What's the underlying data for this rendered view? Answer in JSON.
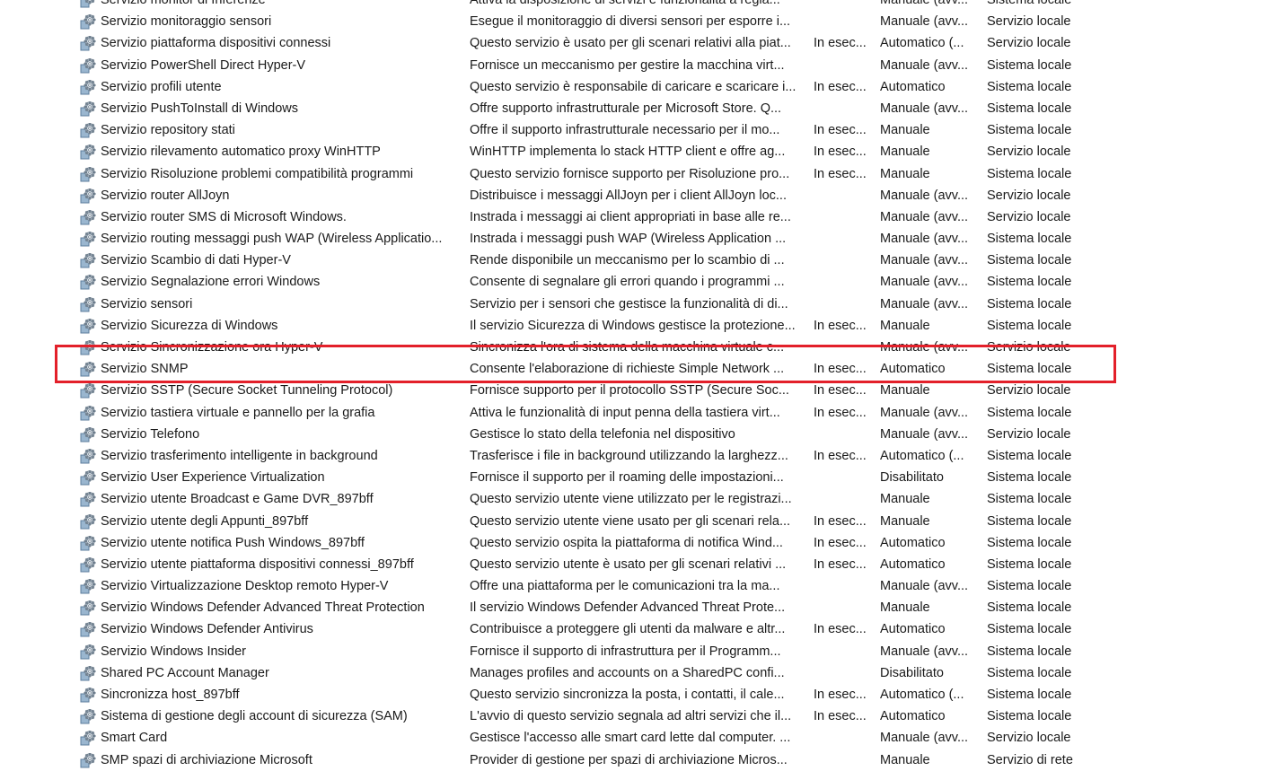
{
  "highlight_color": "#e3202a",
  "row_icon": "gear-icon",
  "services": [
    {
      "name": "Servizio monitor di Inferenze",
      "description": "Attiva la disposizione di servizi e funzionalità a regia...",
      "status": "",
      "startup": "Manuale (avv...",
      "logon": "Sistema locale"
    },
    {
      "name": "Servizio monitoraggio sensori",
      "description": "Esegue il monitoraggio di diversi sensori per esporre i...",
      "status": "",
      "startup": "Manuale (avv...",
      "logon": "Servizio locale"
    },
    {
      "name": "Servizio piattaforma dispositivi connessi",
      "description": "Questo servizio è usato per gli scenari relativi alla piat...",
      "status": "In esec...",
      "startup": "Automatico (...",
      "logon": "Servizio locale"
    },
    {
      "name": "Servizio PowerShell Direct Hyper-V",
      "description": "Fornisce un meccanismo per gestire la macchina virt...",
      "status": "",
      "startup": "Manuale (avv...",
      "logon": "Sistema locale"
    },
    {
      "name": "Servizio profili utente",
      "description": "Questo servizio è responsabile di caricare e scaricare i...",
      "status": "In esec...",
      "startup": "Automatico",
      "logon": "Sistema locale"
    },
    {
      "name": "Servizio PushToInstall di Windows",
      "description": "Offre supporto infrastrutturale per Microsoft Store. Q...",
      "status": "",
      "startup": "Manuale (avv...",
      "logon": "Sistema locale"
    },
    {
      "name": "Servizio repository stati",
      "description": "Offre il supporto infrastrutturale necessario per il mo...",
      "status": "In esec...",
      "startup": "Manuale",
      "logon": "Sistema locale"
    },
    {
      "name": "Servizio rilevamento automatico proxy WinHTTP",
      "description": "WinHTTP implementa lo stack HTTP client e offre ag...",
      "status": "In esec...",
      "startup": "Manuale",
      "logon": "Servizio locale"
    },
    {
      "name": "Servizio Risoluzione problemi compatibilità programmi",
      "description": "Questo servizio fornisce supporto per Risoluzione pro...",
      "status": "In esec...",
      "startup": "Manuale",
      "logon": "Sistema locale"
    },
    {
      "name": "Servizio router AllJoyn",
      "description": "Distribuisce i messaggi AllJoyn per i client AllJoyn loc...",
      "status": "",
      "startup": "Manuale (avv...",
      "logon": "Servizio locale"
    },
    {
      "name": "Servizio router SMS di Microsoft Windows.",
      "description": "Instrada i messaggi ai client appropriati in base alle re...",
      "status": "",
      "startup": "Manuale (avv...",
      "logon": "Servizio locale"
    },
    {
      "name": "Servizio routing messaggi push WAP (Wireless Applicatio...",
      "description": "Instrada i messaggi push WAP (Wireless Application ...",
      "status": "",
      "startup": "Manuale (avv...",
      "logon": "Sistema locale"
    },
    {
      "name": "Servizio Scambio di dati Hyper-V",
      "description": "Rende disponibile un meccanismo per lo scambio di ...",
      "status": "",
      "startup": "Manuale (avv...",
      "logon": "Sistema locale"
    },
    {
      "name": "Servizio Segnalazione errori Windows",
      "description": "Consente di segnalare gli errori quando i programmi ...",
      "status": "",
      "startup": "Manuale (avv...",
      "logon": "Sistema locale"
    },
    {
      "name": "Servizio sensori",
      "description": "Servizio per i sensori che gestisce la funzionalità di di...",
      "status": "",
      "startup": "Manuale (avv...",
      "logon": "Sistema locale"
    },
    {
      "name": "Servizio Sicurezza di Windows",
      "description": "Il servizio Sicurezza di Windows gestisce la protezione...",
      "status": "In esec...",
      "startup": "Manuale",
      "logon": "Sistema locale"
    },
    {
      "name": "Servizio Sincronizzazione ora Hyper-V",
      "description": "Sincronizza l'ora di sistema della macchina virtuale c...",
      "status": "",
      "startup": "Manuale (avv...",
      "logon": "Servizio locale"
    },
    {
      "name": "Servizio SNMP",
      "description": "Consente l'elaborazione di richieste Simple Network ...",
      "status": "In esec...",
      "startup": "Automatico",
      "logon": "Sistema locale",
      "highlighted": true
    },
    {
      "name": "Servizio SSTP (Secure Socket Tunneling Protocol)",
      "description": "Fornisce supporto per il protocollo SSTP (Secure Soc...",
      "status": "In esec...",
      "startup": "Manuale",
      "logon": "Servizio locale"
    },
    {
      "name": "Servizio tastiera virtuale e pannello per la grafia",
      "description": "Attiva le funzionalità di input penna della tastiera virt...",
      "status": "In esec...",
      "startup": "Manuale (avv...",
      "logon": "Sistema locale"
    },
    {
      "name": "Servizio Telefono",
      "description": "Gestisce lo stato della telefonia nel dispositivo",
      "status": "",
      "startup": "Manuale (avv...",
      "logon": "Servizio locale"
    },
    {
      "name": "Servizio trasferimento intelligente in background",
      "description": "Trasferisce i file in background utilizzando la larghezz...",
      "status": "In esec...",
      "startup": "Automatico (...",
      "logon": "Sistema locale"
    },
    {
      "name": "Servizio User Experience Virtualization",
      "description": "Fornisce il supporto per il roaming delle impostazioni...",
      "status": "",
      "startup": "Disabilitato",
      "logon": "Sistema locale"
    },
    {
      "name": "Servizio utente Broadcast e Game DVR_897bff",
      "description": "Questo servizio utente viene utilizzato per le registrazi...",
      "status": "",
      "startup": "Manuale",
      "logon": "Sistema locale"
    },
    {
      "name": "Servizio utente degli Appunti_897bff",
      "description": "Questo servizio utente viene usato per gli scenari rela...",
      "status": "In esec...",
      "startup": "Manuale",
      "logon": "Sistema locale"
    },
    {
      "name": "Servizio utente notifica Push Windows_897bff",
      "description": "Questo servizio ospita la piattaforma di notifica Wind...",
      "status": "In esec...",
      "startup": "Automatico",
      "logon": "Sistema locale"
    },
    {
      "name": "Servizio utente piattaforma dispositivi connessi_897bff",
      "description": "Questo servizio utente è usato per gli scenari relativi ...",
      "status": "In esec...",
      "startup": "Automatico",
      "logon": "Sistema locale"
    },
    {
      "name": "Servizio Virtualizzazione Desktop remoto Hyper-V",
      "description": "Offre una piattaforma per le comunicazioni tra la ma...",
      "status": "",
      "startup": "Manuale (avv...",
      "logon": "Sistema locale"
    },
    {
      "name": "Servizio Windows Defender Advanced Threat Protection",
      "description": "Il servizio Windows Defender Advanced Threat Prote...",
      "status": "",
      "startup": "Manuale",
      "logon": "Sistema locale"
    },
    {
      "name": "Servizio Windows Defender Antivirus",
      "description": "Contribuisce a proteggere gli utenti da malware e altr...",
      "status": "In esec...",
      "startup": "Automatico",
      "logon": "Sistema locale"
    },
    {
      "name": "Servizio Windows Insider",
      "description": "Fornisce il supporto di infrastruttura per il Programm...",
      "status": "",
      "startup": "Manuale (avv...",
      "logon": "Sistema locale"
    },
    {
      "name": "Shared PC Account Manager",
      "description": "Manages profiles and accounts on a SharedPC confi...",
      "status": "",
      "startup": "Disabilitato",
      "logon": "Sistema locale"
    },
    {
      "name": "Sincronizza host_897bff",
      "description": "Questo servizio sincronizza la posta, i contatti, il cale...",
      "status": "In esec...",
      "startup": "Automatico (...",
      "logon": "Sistema locale"
    },
    {
      "name": "Sistema di gestione degli account di sicurezza (SAM)",
      "description": "L'avvio di questo servizio segnala ad altri servizi che il...",
      "status": "In esec...",
      "startup": "Automatico",
      "logon": "Sistema locale"
    },
    {
      "name": "Smart Card",
      "description": "Gestisce l'accesso alle smart card lette dal computer. ...",
      "status": "",
      "startup": "Manuale (avv...",
      "logon": "Servizio locale"
    },
    {
      "name": "SMP spazi di archiviazione Microsoft",
      "description": "Provider di gestione per spazi di archiviazione Micros...",
      "status": "",
      "startup": "Manuale",
      "logon": "Servizio di rete"
    }
  ]
}
